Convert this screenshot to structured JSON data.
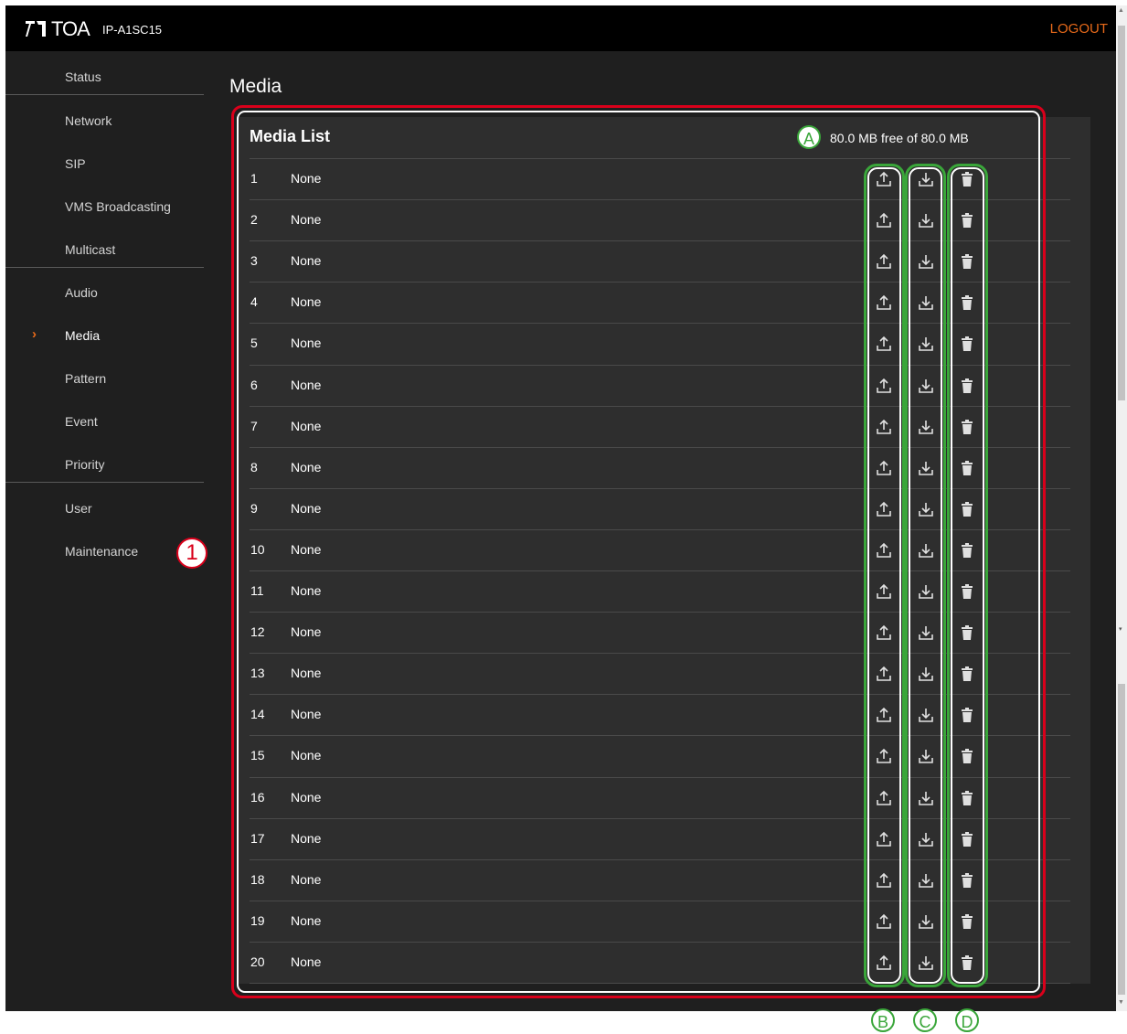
{
  "header": {
    "brand": "TOA",
    "model": "IP-A1SC15",
    "logout_label": "LOGOUT"
  },
  "sidebar": {
    "items": [
      {
        "label": "Status",
        "active": false
      },
      {
        "label": "Network",
        "active": false
      },
      {
        "label": "SIP",
        "active": false
      },
      {
        "label": "VMS Broadcasting",
        "active": false
      },
      {
        "label": "Multicast",
        "active": false
      },
      {
        "label": "Audio",
        "active": false
      },
      {
        "label": "Media",
        "active": true
      },
      {
        "label": "Pattern",
        "active": false
      },
      {
        "label": "Event",
        "active": false
      },
      {
        "label": "Priority",
        "active": false
      },
      {
        "label": "User",
        "active": false
      },
      {
        "label": "Maintenance",
        "active": false
      }
    ],
    "active_marker": "›"
  },
  "main": {
    "page_title": "Media",
    "panel_title": "Media List",
    "storage_text": "80.0 MB free of 80.0 MB",
    "rows": [
      {
        "num": "1",
        "name": "None"
      },
      {
        "num": "2",
        "name": "None"
      },
      {
        "num": "3",
        "name": "None"
      },
      {
        "num": "4",
        "name": "None"
      },
      {
        "num": "5",
        "name": "None"
      },
      {
        "num": "6",
        "name": "None"
      },
      {
        "num": "7",
        "name": "None"
      },
      {
        "num": "8",
        "name": "None"
      },
      {
        "num": "9",
        "name": "None"
      },
      {
        "num": "10",
        "name": "None"
      },
      {
        "num": "11",
        "name": "None"
      },
      {
        "num": "12",
        "name": "None"
      },
      {
        "num": "13",
        "name": "None"
      },
      {
        "num": "14",
        "name": "None"
      },
      {
        "num": "15",
        "name": "None"
      },
      {
        "num": "16",
        "name": "None"
      },
      {
        "num": "17",
        "name": "None"
      },
      {
        "num": "18",
        "name": "None"
      },
      {
        "num": "19",
        "name": "None"
      },
      {
        "num": "20",
        "name": "None"
      }
    ],
    "row_icons": [
      "upload-icon",
      "download-icon",
      "trash-icon"
    ]
  },
  "annotations": {
    "marker_1": "1",
    "marker_a": "A",
    "marker_b": "B",
    "marker_c": "C",
    "marker_d": "D"
  },
  "colors": {
    "accent": "#e86a1a",
    "annotation_red": "#d9001b",
    "annotation_green": "#3aa63a",
    "background": "#1f1f1f",
    "panel": "#2e2e2e"
  }
}
